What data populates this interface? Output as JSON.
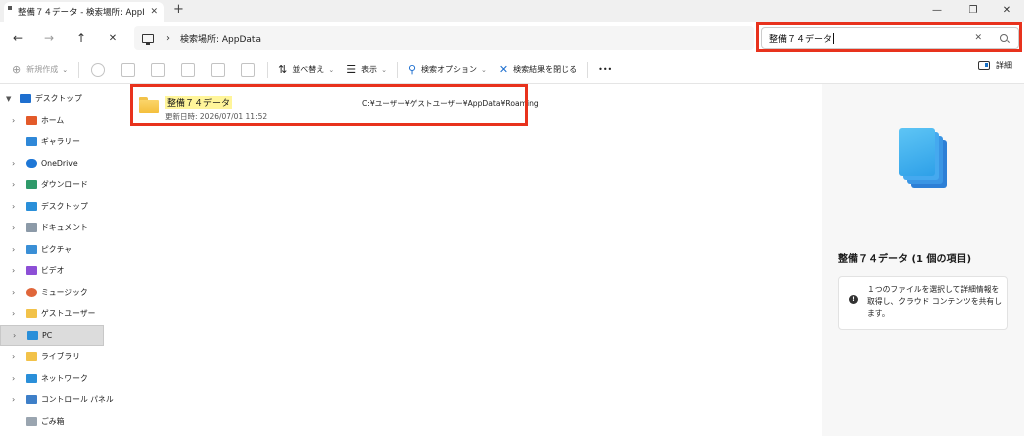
{
  "tab": {
    "title": "整備７４データ - 検索場所: AppI",
    "close": "✕"
  },
  "window": {
    "minimize": "—",
    "maximize": "❐",
    "close": "✕",
    "new_tab": "+"
  },
  "nav": {
    "back": "←",
    "forward": "→",
    "up": "↑",
    "refresh": "✕"
  },
  "address": {
    "separator": "›",
    "breadcrumb": "検索場所: AppData"
  },
  "search": {
    "value": "整備７４データ",
    "clear": "✕"
  },
  "commands": {
    "new": "新規作成",
    "sort": "並べ替え",
    "view": "表示",
    "search_options": "検索オプション",
    "close_search": "検索結果を閉じる",
    "more": "•••",
    "details": "詳細"
  },
  "sidebar": {
    "items": [
      {
        "label": "デスクトップ",
        "icon_color": "#1e6fcf"
      },
      {
        "label": "ホーム",
        "icon_color": "#e35a2a"
      },
      {
        "label": "ギャラリー",
        "icon_color": "#2f88d8"
      },
      {
        "label": "OneDrive",
        "icon_color": "#1e77d6"
      },
      {
        "label": "ダウンロード",
        "icon_color": "#2f9a6a"
      },
      {
        "label": "デスクトップ",
        "icon_color": "#2a8fd9"
      },
      {
        "label": "ドキュメント",
        "icon_color": "#8c9aa8"
      },
      {
        "label": "ピクチャ",
        "icon_color": "#3a8fd6"
      },
      {
        "label": "ビデオ",
        "icon_color": "#8d4fd6"
      },
      {
        "label": "ミュージック",
        "icon_color": "#e0663a"
      },
      {
        "label": "ゲストユーザー",
        "icon_color": "#f2c249"
      },
      {
        "label": "PC",
        "icon_color": "#2a8fd9"
      },
      {
        "label": "ライブラリ",
        "icon_color": "#f2c249"
      },
      {
        "label": "ネットワーク",
        "icon_color": "#2a8fd9"
      },
      {
        "label": "コントロール パネル",
        "icon_color": "#3e7fc8"
      },
      {
        "label": "ごみ箱",
        "icon_color": "#9aa5b0"
      }
    ]
  },
  "result": {
    "name": "整備７４データ",
    "modified": "更新日時: 2026/07/01 11:52",
    "path": "C:¥ユーザー¥ゲストユーザー¥AppData¥Roaming"
  },
  "details_pane": {
    "title": "整備７４データ (1 個の項目)",
    "info_icon": "!",
    "info": "１つのファイルを選択して詳細情報を取得し、クラウド コンテンツを共有します。"
  },
  "colors": {
    "highlight": "#e8321d",
    "selection": "#dcdcdc",
    "match_highlight": "#fff59a"
  }
}
